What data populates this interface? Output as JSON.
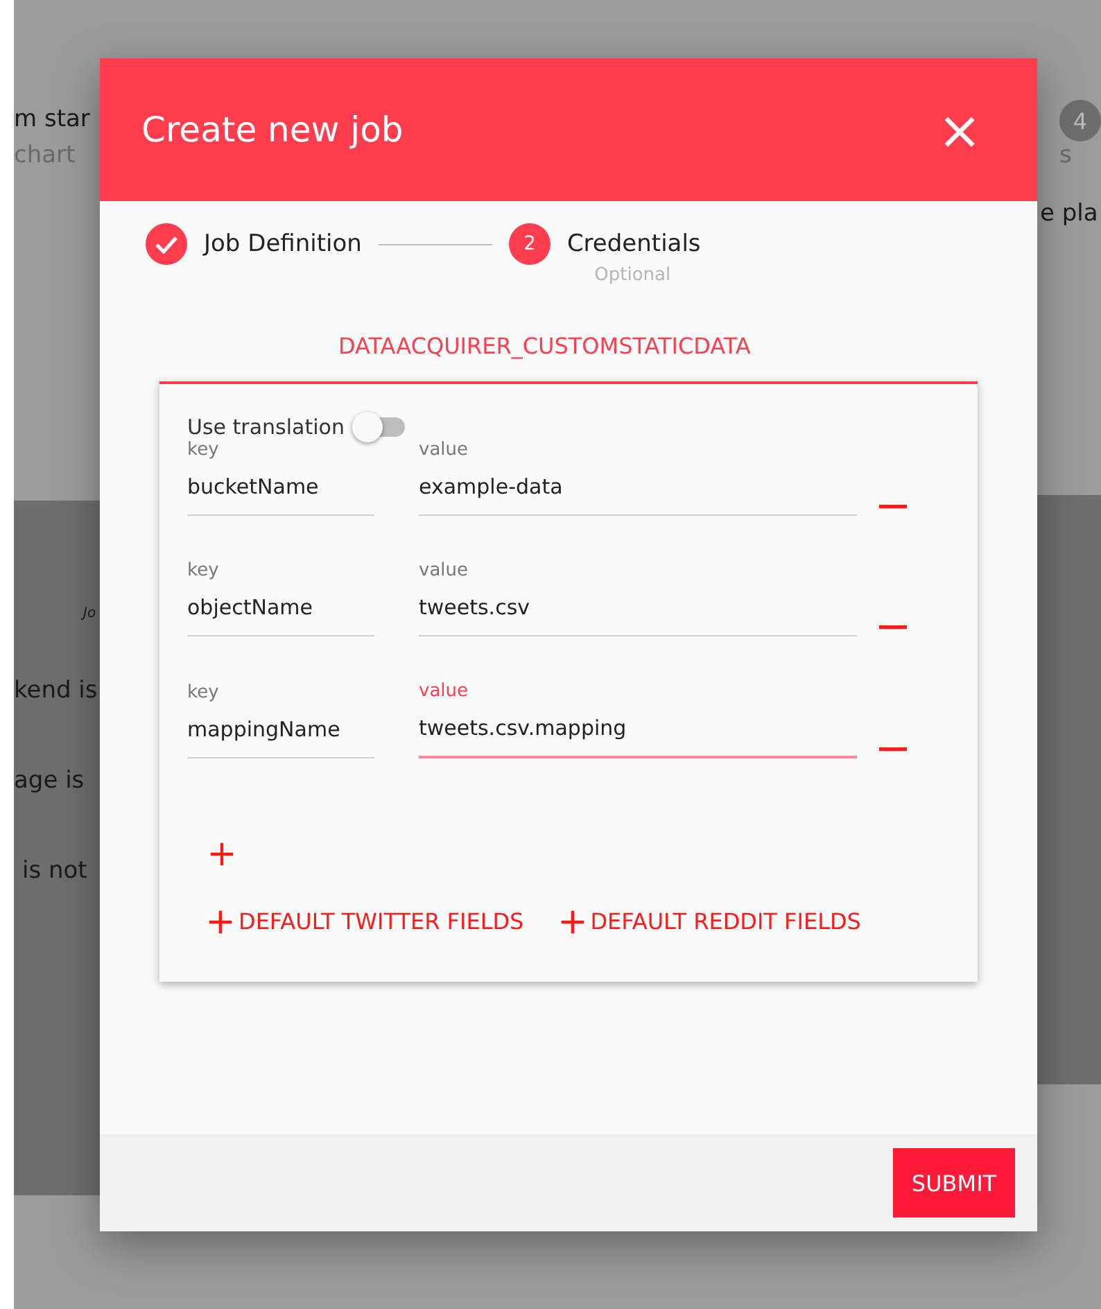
{
  "background": {
    "left_texts": [
      {
        "text": "m star",
        "kind": "dark"
      },
      {
        "text": "chart",
        "kind": "light"
      },
      {
        "text": "Jo",
        "kind": "small"
      },
      {
        "text": "kend is",
        "kind": "dark"
      },
      {
        "text": "age is",
        "kind": "dark"
      },
      {
        "text": "is not",
        "kind": "dark"
      }
    ],
    "step_badge": "4",
    "right_texts": [
      {
        "text": "s",
        "kind": "light"
      },
      {
        "text": "e pla",
        "kind": "dark"
      }
    ]
  },
  "dialog": {
    "title": "Create new job",
    "close": "×",
    "steps": [
      {
        "label": "Job Definition",
        "done": true
      },
      {
        "label": "Credentials",
        "number": "2",
        "done": false,
        "note": "Optional"
      }
    ],
    "section_title": "DATAACQUIRER_CUSTOMSTATICDATA",
    "translation": {
      "label": "Use translation",
      "on": false
    },
    "pairs": [
      {
        "key_label": "key",
        "key": "bucketName",
        "value_label": "value",
        "value": "example-data",
        "focused": false
      },
      {
        "key_label": "key",
        "key": "objectName",
        "value_label": "value",
        "value": "tweets.csv",
        "focused": false
      },
      {
        "key_label": "key",
        "key": "mappingName",
        "value_label": "value",
        "value": "tweets.csv.mapping",
        "focused": true
      }
    ],
    "add_buttons": [
      "DEFAULT TWITTER FIELDS",
      "DEFAULT REDDIT FIELDS"
    ],
    "submit": "SUBMIT"
  }
}
